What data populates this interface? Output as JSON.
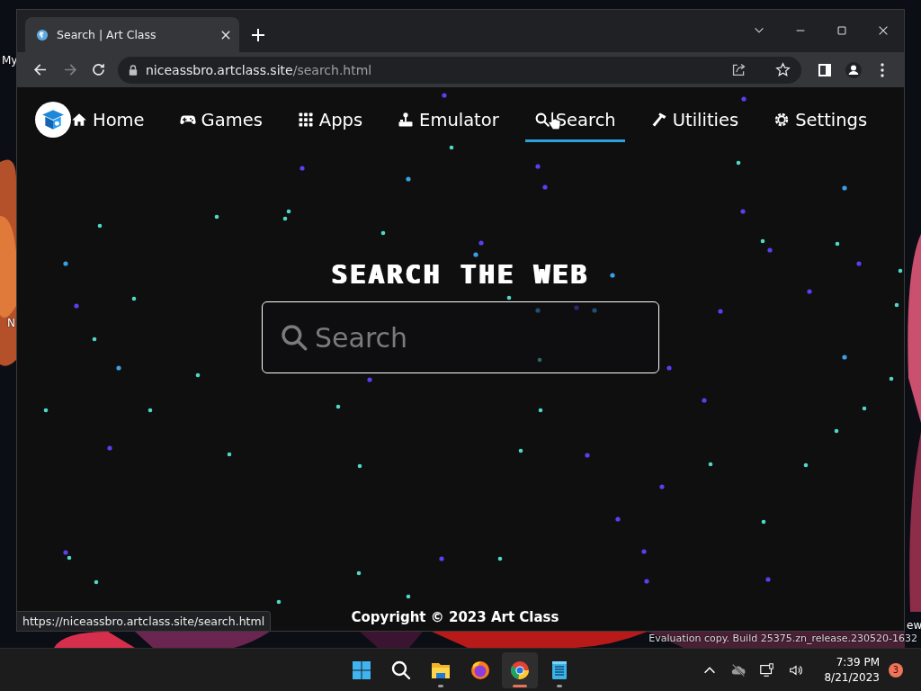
{
  "desktop": {
    "icon_labels": [
      "My",
      "N",
      "ew"
    ],
    "watermark": "Evaluation copy. Build 25375.zn_release.230520-1632"
  },
  "browser": {
    "tabs": [
      {
        "title": "Search | Art Class",
        "selected": true
      }
    ],
    "nav_buttons": [
      {
        "kind": "back",
        "disabled": false
      },
      {
        "kind": "forward",
        "disabled": true
      },
      {
        "kind": "reload",
        "disabled": false
      }
    ],
    "address": {
      "host": "niceassbro.artclass.site",
      "path": "/search.html"
    },
    "status_url": "https://niceassbro.artclass.site/search.html"
  },
  "page": {
    "nav": [
      {
        "kind": "home",
        "label": "Home",
        "selected": false
      },
      {
        "kind": "games",
        "label": "Games",
        "selected": false
      },
      {
        "kind": "apps",
        "label": "Apps",
        "selected": false
      },
      {
        "kind": "emulator",
        "label": "Emulator",
        "selected": false
      },
      {
        "kind": "search",
        "label": "Search",
        "selected": true
      },
      {
        "kind": "utilities",
        "label": "Utilities",
        "selected": false
      },
      {
        "kind": "settings",
        "label": "Settings",
        "selected": false
      }
    ],
    "heading": "SEARCH THE WEB",
    "search": {
      "placeholder": "Search"
    },
    "footer": "Copyright © 2023 Art Class"
  },
  "taskbar": {
    "apps": [
      {
        "kind": "start",
        "running": false,
        "selected": false
      },
      {
        "kind": "search",
        "running": false,
        "selected": false
      },
      {
        "kind": "files",
        "running": true,
        "selected": false
      },
      {
        "kind": "firefox",
        "running": false,
        "selected": false
      },
      {
        "kind": "chrome",
        "running": true,
        "selected": true
      },
      {
        "kind": "notepad",
        "running": true,
        "selected": false
      }
    ],
    "clock": {
      "time": "7:39 PM",
      "date": "8/21/2023"
    },
    "notification_count": "3"
  }
}
